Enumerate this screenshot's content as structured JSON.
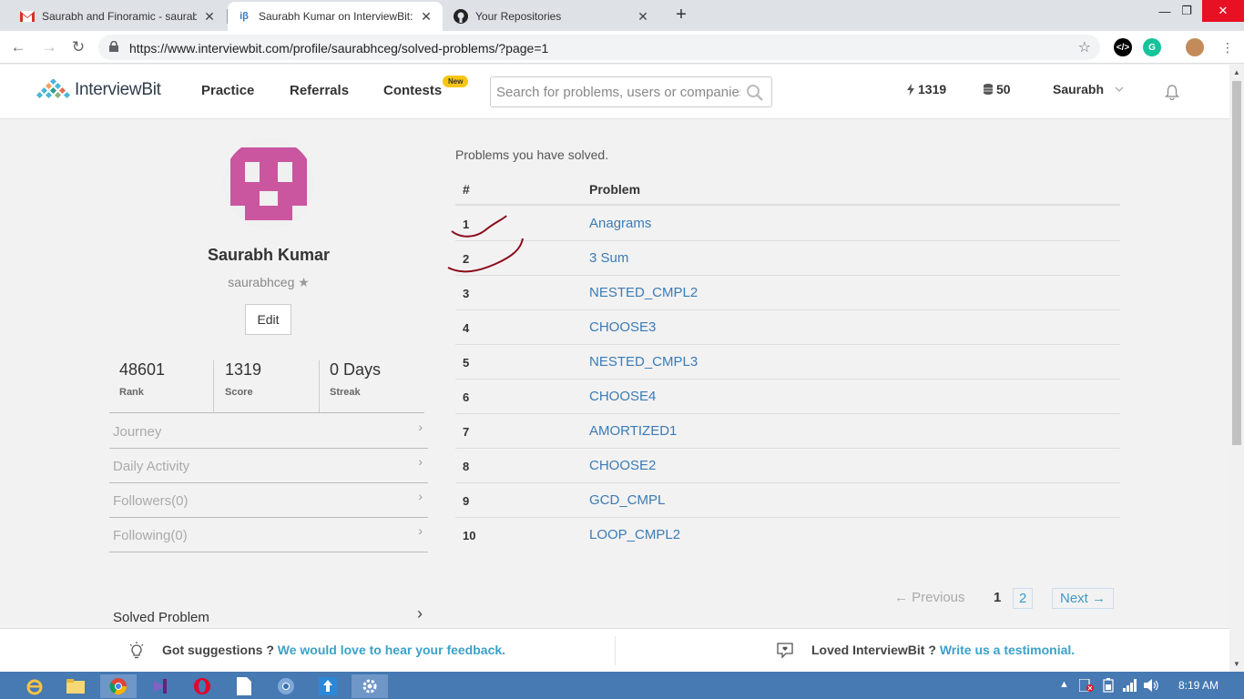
{
  "browser": {
    "tabs": [
      {
        "title": "Saurabh and Finoramic - saurabh",
        "favicon": "gmail-icon"
      },
      {
        "title": "Saurabh Kumar on InterviewBit: C",
        "favicon": "interviewbit-icon",
        "fav_text": "iβ"
      },
      {
        "title": "Your Repositories",
        "favicon": "github-icon"
      }
    ],
    "url": "https://www.interviewbit.com/profile/saurabhceg/solved-problems/?page=1"
  },
  "header": {
    "logo": "InterviewBit",
    "nav": [
      {
        "label": "Practice"
      },
      {
        "label": "Referrals"
      },
      {
        "label": "Contests"
      }
    ],
    "new_badge": "New",
    "search_placeholder": "Search for problems, users or companies",
    "score": "1319",
    "coins": "50",
    "user": "Saurabh"
  },
  "profile": {
    "name": "Saurabh Kumar",
    "username": "saurabhceg",
    "edit_label": "Edit",
    "stats": [
      {
        "value": "48601",
        "label": "Rank"
      },
      {
        "value": "1319",
        "label": "Score"
      },
      {
        "value": "0 Days",
        "label": "Streak"
      }
    ],
    "menu": [
      {
        "label": "Journey"
      },
      {
        "label": "Daily Activity"
      },
      {
        "label": "Followers(0)"
      },
      {
        "label": "Following(0)"
      }
    ],
    "solved_label": "Solved Problem"
  },
  "solved": {
    "caption": "Problems you have solved.",
    "col_num": "#",
    "col_problem": "Problem",
    "rows": [
      {
        "num": "1",
        "problem": "Anagrams"
      },
      {
        "num": "2",
        "problem": "3 Sum"
      },
      {
        "num": "3",
        "problem": "NESTED_CMPL2"
      },
      {
        "num": "4",
        "problem": "CHOOSE3"
      },
      {
        "num": "5",
        "problem": "NESTED_CMPL3"
      },
      {
        "num": "6",
        "problem": "CHOOSE4"
      },
      {
        "num": "7",
        "problem": "AMORTIZED1"
      },
      {
        "num": "8",
        "problem": "CHOOSE2"
      },
      {
        "num": "9",
        "problem": "GCD_CMPL"
      },
      {
        "num": "10",
        "problem": "LOOP_CMPL2"
      }
    ],
    "pagination": {
      "prev": "← Previous",
      "pages": [
        "1",
        "2"
      ],
      "current": "1",
      "next": "Next →"
    }
  },
  "footer": {
    "suggest_text": "Got suggestions ?",
    "suggest_link": "We would love to hear your feedback.",
    "loved_text": "Loved InterviewBit ?",
    "loved_link": "Write us a testimonial."
  },
  "taskbar": {
    "time": "8:19 AM"
  },
  "colors": {
    "link": "#3b7bb5",
    "accent": "#3ba1c9",
    "avatar": "#c9569f",
    "annotation": "#8b0a1a",
    "taskbar": "#4779b3"
  }
}
